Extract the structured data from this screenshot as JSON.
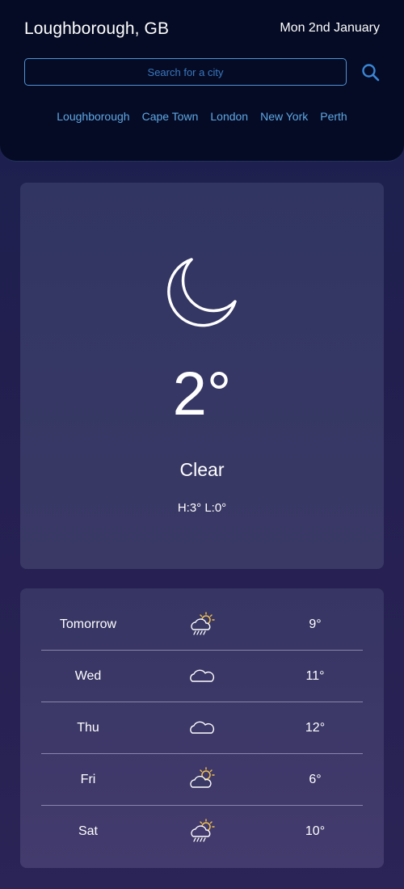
{
  "header": {
    "city": "Loughborough, GB",
    "date": "Mon 2nd January",
    "search_placeholder": "Search for a city",
    "quick_links": [
      "Loughborough",
      "Cape Town",
      "London",
      "New York",
      "Perth"
    ]
  },
  "current": {
    "icon": "moon-icon",
    "temperature": "2°",
    "condition": "Clear",
    "high_low": "H:3° L:0°"
  },
  "forecast": [
    {
      "day": "Tomorrow",
      "icon": "sun-cloud-rain-icon",
      "temp": "9°"
    },
    {
      "day": "Wed",
      "icon": "cloud-icon",
      "temp": "11°"
    },
    {
      "day": "Thu",
      "icon": "cloud-icon",
      "temp": "12°"
    },
    {
      "day": "Fri",
      "icon": "sun-cloud-icon",
      "temp": "6°"
    },
    {
      "day": "Sat",
      "icon": "sun-cloud-rain-icon",
      "temp": "10°"
    }
  ],
  "colors": {
    "header_bg": "#050b24",
    "accent": "#5fa8e6",
    "sun": "#f2c14e"
  }
}
